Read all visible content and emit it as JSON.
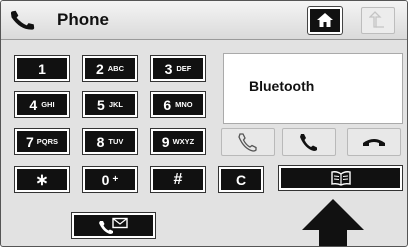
{
  "header": {
    "title": "Phone",
    "icon": "phone-handset-icon",
    "home_icon": "home-icon",
    "back_icon": "back-arrow-icon"
  },
  "keypad": [
    {
      "digit": "1",
      "letters": ""
    },
    {
      "digit": "2",
      "letters": "ABC"
    },
    {
      "digit": "3",
      "letters": "DEF"
    },
    {
      "digit": "4",
      "letters": "GHI"
    },
    {
      "digit": "5",
      "letters": "JKL"
    },
    {
      "digit": "6",
      "letters": "MNO"
    },
    {
      "digit": "7",
      "letters": "PQRS"
    },
    {
      "digit": "8",
      "letters": "TUV"
    },
    {
      "digit": "9",
      "letters": "WXYZ"
    },
    {
      "digit": "∗",
      "letters": ""
    },
    {
      "digit": "0",
      "letters": "+"
    },
    {
      "digit": "#",
      "letters": ""
    }
  ],
  "clear_label": "C",
  "display": {
    "text": "Bluetooth"
  },
  "controls": {
    "redial_icon": "handset-outline-icon",
    "call_icon": "call-handset-icon",
    "end_call_icon": "end-call-icon",
    "phonebook_icon": "phonebook-icon",
    "voicemail_icon": "voicemail-handset-icon",
    "pointer_icon": "up-arrow-pointer-icon"
  }
}
